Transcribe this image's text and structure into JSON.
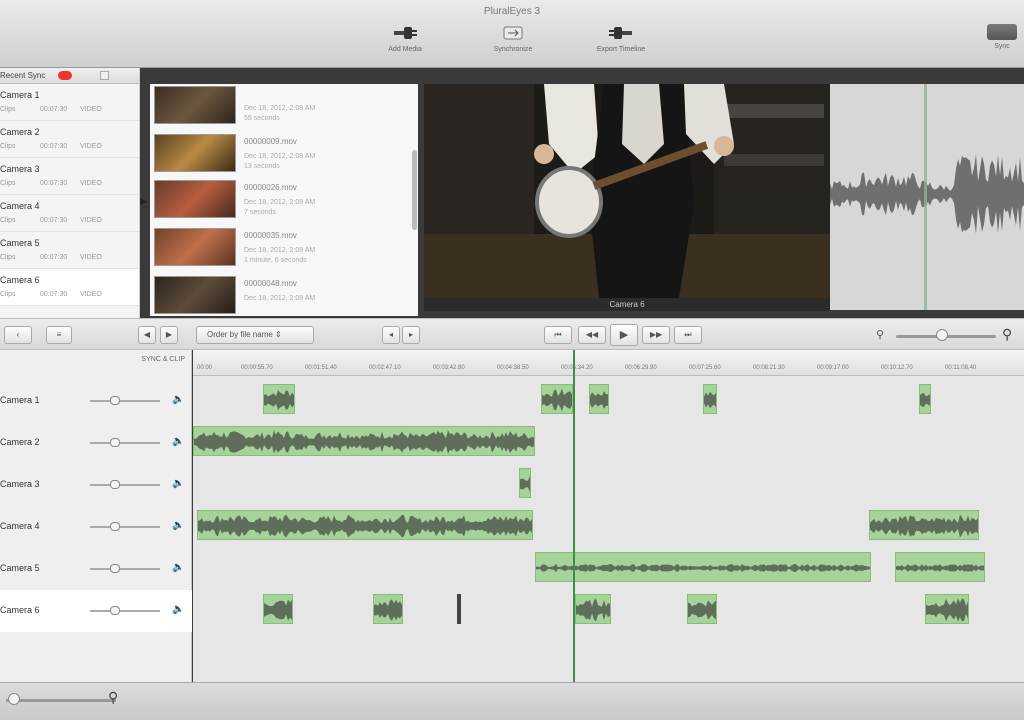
{
  "window": {
    "title": "PluralEyes 3"
  },
  "toolbar": {
    "add_media_label": "Add Media",
    "synchronize_label": "Synchronize",
    "export_timeline_label": "Export Timeline",
    "sync_label": "Sync"
  },
  "cameras": {
    "header": "Recent Sync",
    "items": [
      {
        "name": "Camera 1",
        "meta": [
          "Clips",
          "00:07:30",
          "VIDEO"
        ]
      },
      {
        "name": "Camera 2",
        "meta": [
          "Clips",
          "00:07:30",
          "VIDEO"
        ]
      },
      {
        "name": "Camera 3",
        "meta": [
          "Clips",
          "00:07:30",
          "VIDEO"
        ]
      },
      {
        "name": "Camera 4",
        "meta": [
          "Clips",
          "00:07:30",
          "VIDEO"
        ]
      },
      {
        "name": "Camera 5",
        "meta": [
          "Clips",
          "00:07:30",
          "VIDEO"
        ]
      },
      {
        "name": "Camera 6",
        "meta": [
          "Clips",
          "00:07:30",
          "VIDEO"
        ]
      }
    ]
  },
  "clips": [
    {
      "name": "",
      "date": "Dec 18, 2012, 2:08 AM",
      "info": "55 seconds"
    },
    {
      "name": "00000009.mov",
      "date": "Dec 18, 2012, 2:08 AM",
      "info": "13 seconds"
    },
    {
      "name": "00000026.mov",
      "date": "Dec 18, 2012, 2:08 AM",
      "info": "7 seconds"
    },
    {
      "name": "00000035.mov",
      "date": "Dec 18, 2012, 2:08 AM",
      "info": "1 minute, 6 seconds"
    },
    {
      "name": "00000048.mov",
      "date": "Dec 18, 2012, 2:08 AM",
      "info": ""
    }
  ],
  "viewer": {
    "label": "Camera 6"
  },
  "controls": {
    "order_select": "Order by file name",
    "transport": [
      "⏮",
      "◀◀",
      "▶",
      "▶▶",
      "⏭"
    ]
  },
  "tracks": {
    "sync_label": "SYNC & CLIP",
    "names": [
      "Camera 1",
      "Camera 2",
      "Camera 3",
      "Camera 4",
      "Camera 5",
      "Camera 6"
    ]
  },
  "ruler": {
    "labels": [
      "00:00",
      "00:00:55.70",
      "00:01:51.40",
      "00:02:47.10",
      "00:03:42.80",
      "00:04:38.50",
      "00:05:34.20",
      "00:06:29.90",
      "00:07:25.60",
      "00:08:21.30",
      "00:09:17.00",
      "00:10:12.70",
      "00:11:08.40"
    ]
  },
  "colors": {
    "clip_fill": "#a6d39a",
    "waveform": "#5e6e5a",
    "playhead": "#3f8d4b",
    "badge": "#e33333"
  }
}
